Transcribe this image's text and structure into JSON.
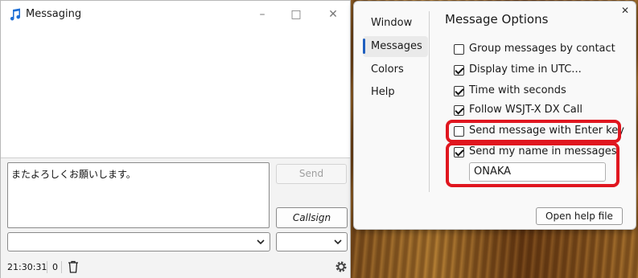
{
  "messaging": {
    "title": "Messaging",
    "compose_text": "またよろしくお願いします。",
    "send_label": "Send",
    "callsign_label": "Callsign",
    "status": {
      "time": "21:30:31",
      "count": "0"
    },
    "icons": {
      "app": "music-note-icon",
      "trash": "trash-icon",
      "settings": "gear-icon"
    }
  },
  "options": {
    "nav": [
      "Window",
      "Messages",
      "Colors",
      "Help"
    ],
    "active_nav": "Messages",
    "section_title": "Message Options",
    "checkboxes": [
      {
        "label": "Group messages by contact",
        "checked": false
      },
      {
        "label": "Display time in UTC...",
        "checked": true
      },
      {
        "label": "Time with seconds",
        "checked": true
      },
      {
        "label": "Follow WSJT-X DX Call",
        "checked": true
      },
      {
        "label": "Send message with Enter key",
        "checked": false
      },
      {
        "label": "Send my name in messages",
        "checked": true
      }
    ],
    "name_value": "ONAKA",
    "help_button": "Open help file",
    "close_label": "✕"
  },
  "colors": {
    "accent": "#1f5fbf",
    "highlight": "#e0161f"
  }
}
